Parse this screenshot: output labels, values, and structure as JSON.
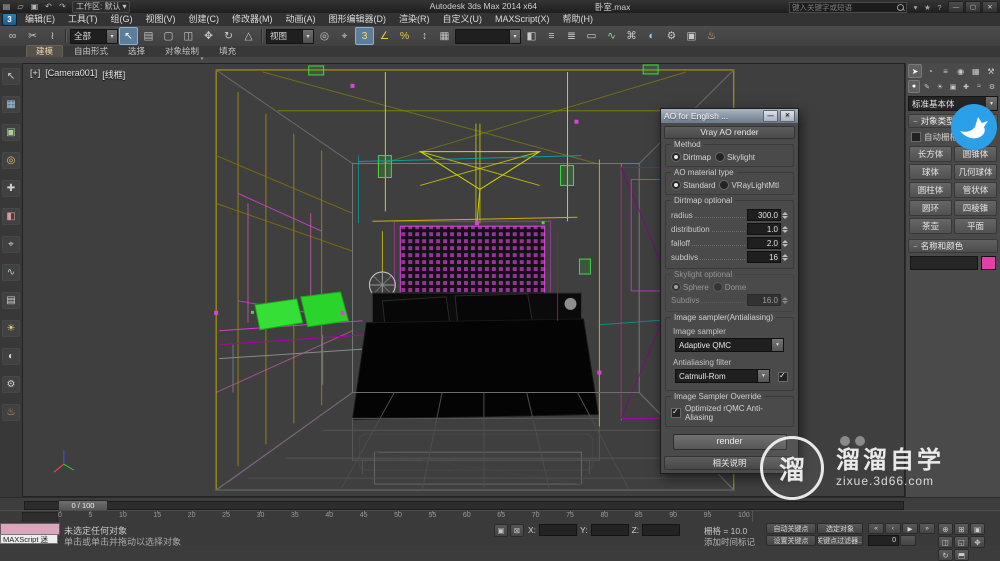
{
  "ui": {
    "caret_down": "▾",
    "rollout_minus": "−",
    "app_button": "3"
  },
  "window": {
    "app_title": "Autodesk 3ds Max  2014 x64",
    "file_name": "卧室.max",
    "workspace_label": "工作区: 默认",
    "search_placeholder": "键入关键字或短语"
  },
  "quick_access": [
    {
      "name": "new-file-icon",
      "glyph": "▤"
    },
    {
      "name": "open-file-icon",
      "glyph": "▱"
    },
    {
      "name": "save-icon",
      "glyph": "▣"
    },
    {
      "name": "undo-icon",
      "glyph": "↶"
    },
    {
      "name": "redo-icon",
      "glyph": "↷"
    }
  ],
  "infocenter_icons": [
    {
      "name": "search-options-icon",
      "glyph": "▾"
    },
    {
      "name": "favorites-star-icon",
      "glyph": "★"
    },
    {
      "name": "help-icon",
      "glyph": "?"
    }
  ],
  "window_buttons": [
    {
      "name": "minimize-button",
      "glyph": "—"
    },
    {
      "name": "restore-button",
      "glyph": "▢"
    },
    {
      "name": "close-button",
      "glyph": "✕"
    }
  ],
  "menu_bar": [
    "编辑(E)",
    "工具(T)",
    "组(G)",
    "视图(V)",
    "创建(C)",
    "修改器(M)",
    "动画(A)",
    "图形编辑器(D)",
    "渲染(R)",
    "自定义(U)",
    "MAXScript(X)",
    "帮助(H)"
  ],
  "toolbar": {
    "filter_value": "全部",
    "coord_value": "视图",
    "named_value": "",
    "group1": [
      {
        "name": "select-and-link-icon",
        "glyph": "∞"
      },
      {
        "name": "unlink-selection-icon",
        "glyph": "✂"
      },
      {
        "name": "bind-to-space-warp-icon",
        "glyph": "≀"
      }
    ],
    "group2": [
      {
        "name": "select-object-icon",
        "glyph": "↖",
        "cls": "active"
      },
      {
        "name": "select-by-name-icon",
        "glyph": "▤"
      },
      {
        "name": "rectangular-selection-region-icon",
        "glyph": "▢"
      },
      {
        "name": "window-crossing-icon",
        "glyph": "◫"
      },
      {
        "name": "select-and-move-icon",
        "glyph": "✥"
      },
      {
        "name": "select-and-rotate-icon",
        "glyph": "↻"
      },
      {
        "name": "select-and-scale-icon",
        "glyph": "△"
      }
    ],
    "group3": [
      {
        "name": "use-pivot-point-icon",
        "glyph": "◎"
      },
      {
        "name": "select-and-manipulate-icon",
        "glyph": "⌖"
      },
      {
        "name": "snaps-toggle-icon",
        "glyph": "3",
        "cls": "active",
        "color": "#ffd966"
      },
      {
        "name": "angle-snap-icon",
        "glyph": "∠",
        "color": "#e8c84a"
      },
      {
        "name": "percent-snap-icon",
        "glyph": "%",
        "color": "#e8c84a"
      },
      {
        "name": "spinner-snap-icon",
        "glyph": "↕"
      },
      {
        "name": "named-selection-sets-icon",
        "glyph": "▦"
      }
    ],
    "group4": [
      {
        "name": "mirror-icon",
        "glyph": "◧"
      },
      {
        "name": "align-icon",
        "glyph": "≡"
      },
      {
        "name": "layer-manager-icon",
        "glyph": "≣"
      },
      {
        "name": "ribbon-toggle-icon",
        "glyph": "▭"
      },
      {
        "name": "curve-editor-icon",
        "glyph": "∿",
        "color": "#9ad49a"
      },
      {
        "name": "schematic-view-icon",
        "glyph": "⌘"
      },
      {
        "name": "material-editor-icon",
        "glyph": "◐",
        "color": "#9ac9e8"
      },
      {
        "name": "render-setup-icon",
        "glyph": "⚙",
        "color": "#c9c9c9"
      },
      {
        "name": "rendered-frame-window-icon",
        "glyph": "▣"
      },
      {
        "name": "render-production-icon",
        "glyph": "♨",
        "color": "#e8b87a"
      }
    ]
  },
  "ribbon": {
    "tabs": [
      {
        "label": "建模",
        "cls": "active"
      },
      {
        "label": "自由形式"
      },
      {
        "label": "选择"
      },
      {
        "label": "对象绘制"
      },
      {
        "label": "填充"
      }
    ]
  },
  "left_toolbar": [
    {
      "name": "left-toolbar-icon",
      "glyph": "↖",
      "color": "#cfcfcf"
    },
    {
      "name": "left-toolbar-icon",
      "glyph": "▦",
      "color": "#9fc9e8"
    },
    {
      "name": "left-toolbar-icon",
      "glyph": "▣",
      "color": "#a8d49a"
    },
    {
      "name": "left-toolbar-icon",
      "glyph": "◎",
      "color": "#e8c87a"
    },
    {
      "name": "left-toolbar-icon",
      "glyph": "✚",
      "color": "#cfcfcf"
    },
    {
      "name": "left-toolbar-icon",
      "glyph": "◧",
      "color": "#d49a9a"
    },
    {
      "name": "left-toolbar-icon",
      "glyph": "⌖",
      "color": "#cfcfcf"
    },
    {
      "name": "left-toolbar-icon",
      "glyph": "∿",
      "color": "#9ad4c9"
    },
    {
      "name": "left-toolbar-icon",
      "glyph": "▤",
      "color": "#cfcfcf"
    },
    {
      "name": "left-toolbar-icon",
      "glyph": "☀",
      "color": "#e8d47a"
    },
    {
      "name": "left-toolbar-icon",
      "glyph": "◐",
      "color": "#cfcfcf"
    },
    {
      "name": "left-toolbar-icon",
      "glyph": "⚙",
      "color": "#cfcfcf"
    },
    {
      "name": "left-toolbar-icon",
      "glyph": "♨",
      "color": "#d4a87a"
    }
  ],
  "viewport": {
    "menu_label": "[+]",
    "pov_label": "[Camera001]",
    "shading_label": "[线框]"
  },
  "command_panel": {
    "tabs": [
      {
        "name": "create-tab",
        "glyph": "➤",
        "cls": "active"
      },
      {
        "name": "modify-tab",
        "glyph": "◔"
      },
      {
        "name": "hierarchy-tab",
        "glyph": "≡"
      },
      {
        "name": "motion-tab",
        "glyph": "◉"
      },
      {
        "name": "display-tab",
        "glyph": "▦"
      },
      {
        "name": "utilities-tab",
        "glyph": "⚒"
      }
    ],
    "subtabs": [
      {
        "name": "geometry-subtab",
        "glyph": "●",
        "cls": "active"
      },
      {
        "name": "shapes-subtab",
        "glyph": "✎"
      },
      {
        "name": "lights-subtab",
        "glyph": "☀"
      },
      {
        "name": "cameras-subtab",
        "glyph": "▣"
      },
      {
        "name": "helpers-subtab",
        "glyph": "✚"
      },
      {
        "name": "space-warps-subtab",
        "glyph": "≈"
      },
      {
        "name": "systems-subtab",
        "glyph": "⚙"
      }
    ],
    "category_value": "标准基本体",
    "object_type_header": "对象类型",
    "autogrid_label": "自动栅格",
    "object_buttons": [
      "长方体",
      "圆锥体",
      "球体",
      "几何球体",
      "圆柱体",
      "管状体",
      "圆环",
      "四棱锥",
      "茶壶",
      "平面"
    ],
    "name_color_header": "名称和颜色",
    "name_value": "",
    "color_swatch": "#e23fa9"
  },
  "ao_dialog": {
    "title": "AO for English ...",
    "min_glyph": "—",
    "close_glyph": "✕",
    "header": "Vray AO render",
    "method_label": "Method",
    "method_options": [
      {
        "label": "Dirtmap",
        "cls": "sel"
      },
      {
        "label": "Skylight"
      }
    ],
    "material_label": "AO material type",
    "material_options": [
      {
        "label": "Standard",
        "cls": "sel"
      },
      {
        "label": "VRayLightMtl"
      }
    ],
    "dirtmap_label": "Dirtmap optional",
    "dirtmap_fields": [
      {
        "label": "radius",
        "value": "300.0"
      },
      {
        "label": "distribution",
        "value": "1.0"
      },
      {
        "label": "falloff",
        "value": "2.0"
      },
      {
        "label": "subdivs",
        "value": "16"
      }
    ],
    "skylight_label": "Skylight optional",
    "skylight_options": [
      {
        "label": "Sphere",
        "cls": "sel"
      },
      {
        "label": "Dome"
      }
    ],
    "skylight_subdivs_label": "Subdivs",
    "skylight_subdivs_value": "16.0",
    "sampler_label": "Image sampler(Antialiasing)",
    "image_sampler_label": "Image sampler",
    "image_sampler_value": "Adaptive QMC",
    "aa_filter_label": "Antialiasing filter",
    "aa_filter_value": "Catmull-Rom",
    "override_label": "Image Sampler Override",
    "override_checkbox_label": "Optimized rQMC Anti-Aliasing",
    "render_button_label": "render",
    "footer": "相关说明"
  },
  "timeline": {
    "slider_label": "0 / 100",
    "ticks": [
      "0",
      "5",
      "10",
      "15",
      "20",
      "25",
      "30",
      "35",
      "40",
      "45",
      "50",
      "55",
      "60",
      "65",
      "70",
      "75",
      "80",
      "85",
      "90",
      "95",
      "100"
    ]
  },
  "status_bar": {
    "listener_text": "MAXScript 迷",
    "status_line": "未选定任何对象",
    "prompt_line": "单击或单击并拖动以选择对象",
    "toggle_icons": [
      {
        "name": "isolate-selection-toggle-icon",
        "glyph": "▣"
      },
      {
        "name": "selection-lock-toggle-icon",
        "glyph": "⊠"
      }
    ],
    "coord_labels": {
      "x": "X:",
      "y": "Y:",
      "z": "Z:"
    },
    "coord_values": {
      "x": "",
      "y": "",
      "z": ""
    },
    "grid_label": "栅格 = 10.0",
    "time_tag_label": "添加时间标记",
    "auto_key_label": "自动关键点",
    "set_key_label": "设置关键点",
    "selected_filter_label": "选定对象",
    "key_filters_label": "关键点过滤器...",
    "frame_value": "0",
    "transport": [
      {
        "name": "go-to-start-icon",
        "glyph": "«"
      },
      {
        "name": "previous-frame-icon",
        "glyph": "‹"
      },
      {
        "name": "play-animation-icon",
        "glyph": "▶"
      },
      {
        "name": "go-to-end-icon",
        "glyph": "»"
      }
    ],
    "nav_icons": [
      {
        "name": "zoom-icon",
        "glyph": "⊕"
      },
      {
        "name": "zoom-all-icon",
        "glyph": "⊞"
      },
      {
        "name": "zoom-extents-icon",
        "glyph": "▣"
      },
      {
        "name": "zoom-extents-all-icon",
        "glyph": "◫"
      },
      {
        "name": "zoom-region-icon",
        "glyph": "◱"
      },
      {
        "name": "pan-icon",
        "glyph": "✥"
      },
      {
        "name": "orbit-icon",
        "glyph": "↻"
      },
      {
        "name": "maximize-viewport-icon",
        "glyph": "⬒"
      }
    ]
  },
  "watermark": {
    "logo_char": "溜",
    "title": "溜溜自学",
    "url": "zixue.3d66.com"
  }
}
